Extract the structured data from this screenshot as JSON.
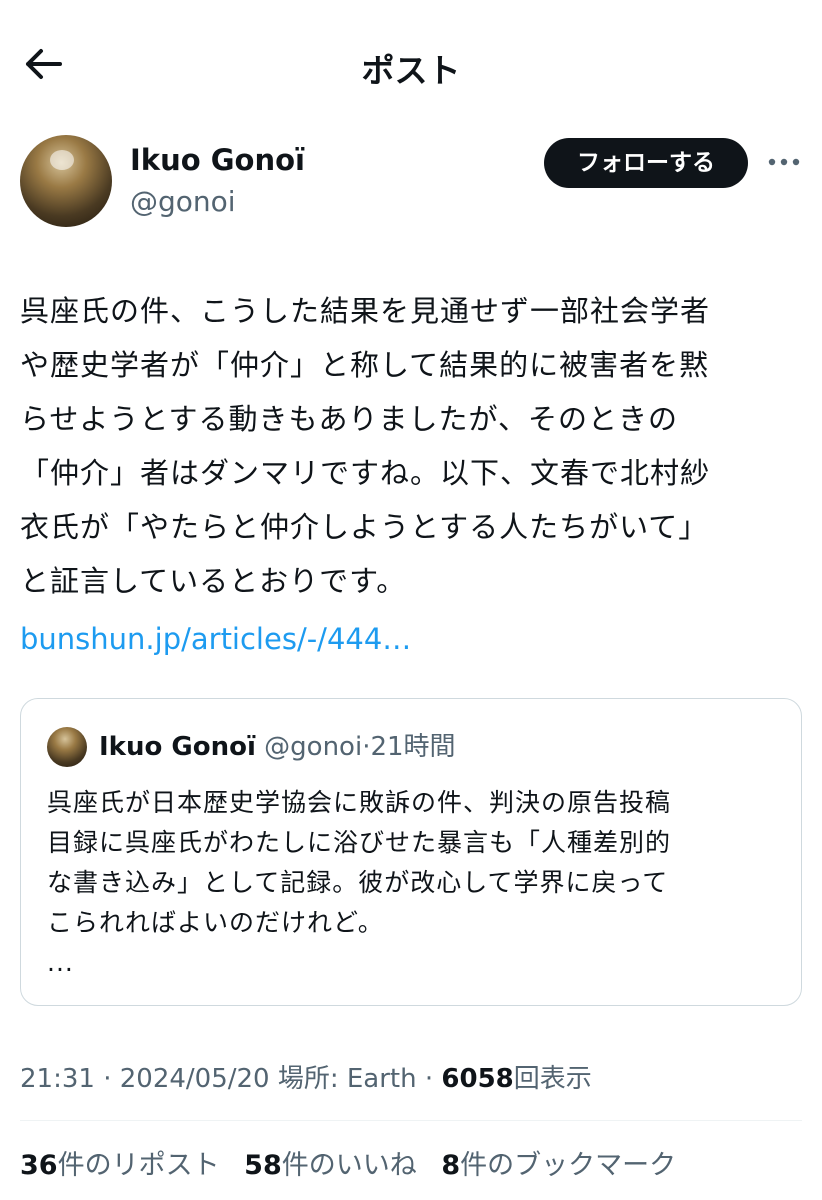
{
  "header": {
    "title": "ポスト",
    "back_icon": "arrow-left-icon"
  },
  "author": {
    "name": "Ikuo Gonoï",
    "handle": "@gonoi",
    "follow_label": "フォローする",
    "more_icon": "ellipsis-icon"
  },
  "post": {
    "lines": [
      "呉座氏の件、こうした結果を見通せず一部社会学者",
      "や歴史学者が「仲介」と称して結果的に被害者を黙",
      "らせようとする動きもありましたが、そのときの",
      "「仲介」者はダンマリですね。以下、文春で北村紗",
      "衣氏が「やたらと仲介しようとする人たちがいて」",
      "と証言しているとおりです。"
    ],
    "link": "bunshun.jp/articles/-/444…"
  },
  "quote": {
    "name": "Ikuo Gonoï",
    "handle": "@gonoi",
    "sep": "·",
    "time": "21時間",
    "lines": [
      "呉座氏が日本歴史学協会に敗訴の件、判決の原告投稿",
      "目録に呉座氏がわたしに浴びせた暴言も「人種差別的",
      "な書き込み」として記録。彼が改心して学界に戻って",
      "こられればよいのだけれど。",
      "..."
    ]
  },
  "meta": {
    "time": "21:31",
    "sep1": "·",
    "date": "2024/05/20",
    "location": "場所: Earth",
    "sep2": "·",
    "views": "6058",
    "views_label": "回表示"
  },
  "stats": [
    {
      "count": "36",
      "label": "件のリポスト"
    },
    {
      "count": "58",
      "label": "件のいいね"
    },
    {
      "count": "8",
      "label": "件のブックマーク"
    }
  ]
}
